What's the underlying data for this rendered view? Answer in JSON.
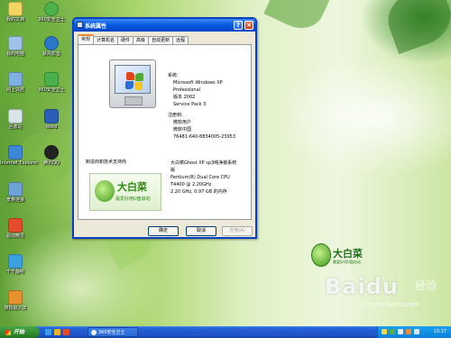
{
  "desktop": {
    "icons": [
      {
        "label": "我的文档",
        "icon": "my-documents-icon",
        "color": "#f2d463"
      },
      {
        "label": "我的电脑",
        "icon": "my-computer-icon",
        "color": "#9fc3e8"
      },
      {
        "label": "网上邻居",
        "icon": "network-places-icon",
        "color": "#7fb0e2"
      },
      {
        "label": "回收站",
        "icon": "recycle-bin-icon",
        "color": "#d8e3ea"
      },
      {
        "label": "Internet Explorer",
        "icon": "internet-explorer-icon",
        "color": "#3b86d9"
      },
      {
        "label": "宽带连接",
        "icon": "broadband-connection-icon",
        "color": "#6ea3d8"
      },
      {
        "label": "360安全卫士",
        "icon": "360-safe-icon",
        "color": "#4bb14b"
      },
      {
        "label": "腾讯QQ",
        "icon": "qq-icon",
        "color": "#222222"
      },
      {
        "label": "暴风影音",
        "icon": "media-player-icon",
        "color": "#2a76c9"
      },
      {
        "label": "Word",
        "icon": "word-icon",
        "color": "#2b5eb8"
      },
      {
        "label": "千千静听",
        "icon": "ttplayer-icon",
        "color": "#3aa0e0"
      },
      {
        "label": "驱动精灵",
        "icon": "driver-genius-icon",
        "color": "#e64b2a"
      },
      {
        "label": "搜狗输入法",
        "icon": "sogou-input-icon",
        "color": "#e7902c"
      }
    ],
    "brand_logo": {
      "name": "大白菜",
      "slogan": "最爱好用U盘启动"
    },
    "watermark": {
      "text": "Baidu",
      "suffix": "经验",
      "url": "jingyan.baidu.com"
    }
  },
  "window": {
    "title": "系统属性",
    "tabs": [
      "常规",
      "计算机名",
      "硬件",
      "高级",
      "自动更新",
      "远程"
    ],
    "active_tab": "常规",
    "system_heading": "系统:",
    "os_name": "Microsoft Windows XP",
    "edition": "Professional",
    "version": "版本 2002",
    "service_pack": "Service Pack 3",
    "registered_heading": "注册到:",
    "registered_user": "微软用户",
    "registered_org": "微软中国",
    "product_id": "76481-640-8834005-23953",
    "manufacturer_label": "制造商和技术支持商",
    "manufacturer_lines": [
      "大白菜Ghost XP sp3纯净装系统",
      "版",
      "Pentium(R) Dual Core CPU",
      "T4400 @ 2.20GHz",
      "2.20 GHz, 0.97 GB 的内存"
    ],
    "logo_brand": "大白菜",
    "logo_slogan": "最爱好用U盘启动",
    "buttons": {
      "ok": "确定",
      "cancel": "取消",
      "apply": "应用(A)"
    }
  },
  "taskbar": {
    "start_label": "开始",
    "task_label": "360安全卫士",
    "clock": "13:17"
  },
  "colors": {
    "titlebar": "#0a5be0",
    "taskbar": "#2561d6",
    "start_button": "#2f8a30",
    "tray": "#0e7fdc"
  }
}
